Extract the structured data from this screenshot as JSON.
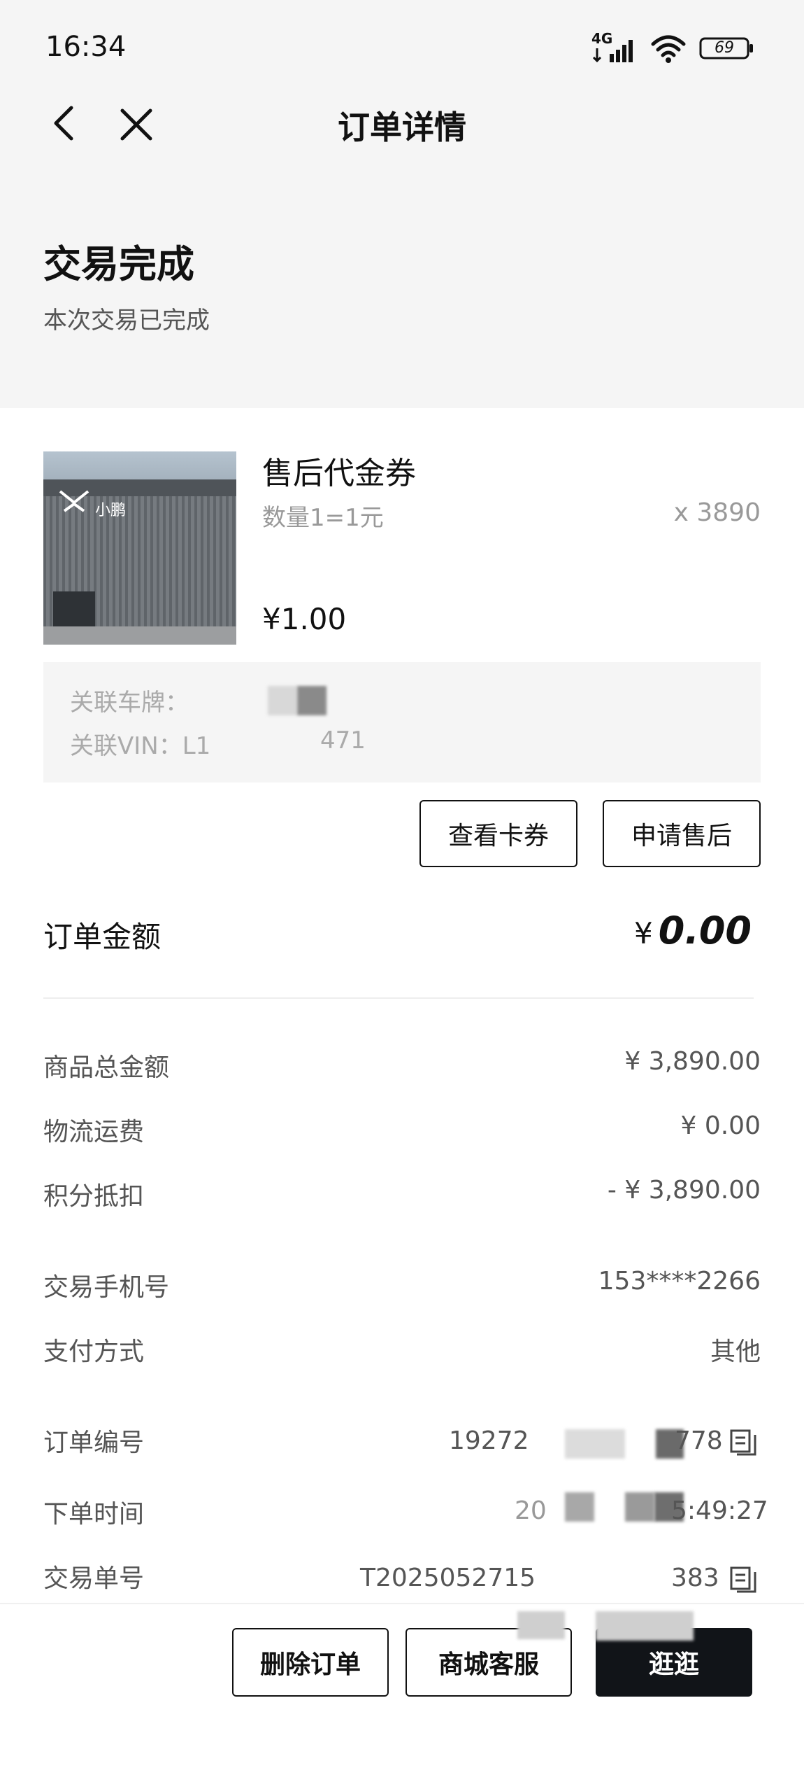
{
  "status_bar": {
    "time": "16:34",
    "network": "4G",
    "battery": "69"
  },
  "nav": {
    "title": "订单详情"
  },
  "order_status": {
    "title": "交易完成",
    "subtitle": "本次交易已完成"
  },
  "product": {
    "image_brand_text": "小鹏",
    "name": "售后代金券",
    "spec": "数量1=1元",
    "quantity": "x 3890",
    "price": "¥1.00"
  },
  "related": {
    "plate_label": "关联车牌：",
    "plate_value_partial": "",
    "vin_label": "关联VIN：",
    "vin_value_start": "L1",
    "vin_value_end": "471"
  },
  "actions": {
    "view_card": "查看卡券",
    "apply_after_sale": "申请售后"
  },
  "order_amount": {
    "label": "订单金额",
    "currency": "¥",
    "value": "0.00"
  },
  "price_rows": [
    {
      "label": "商品总金额",
      "value": "¥ 3,890.00"
    },
    {
      "label": "物流运费",
      "value": "¥ 0.00"
    },
    {
      "label": "积分抵扣",
      "value": "- ¥ 3,890.00"
    }
  ],
  "info_rows": [
    {
      "label": "交易手机号",
      "value": "153****2266"
    },
    {
      "label": "支付方式",
      "value": "其他"
    }
  ],
  "id_rows": [
    {
      "label": "订单编号",
      "value_start": "19272",
      "value_end": "778"
    },
    {
      "label": "下单时间",
      "value_start": "20",
      "value_end": "5:49:27"
    },
    {
      "label": "交易单号",
      "value_start": "T2025052715",
      "value_end": "383"
    }
  ],
  "bottom": {
    "delete_order": "删除订单",
    "customer_service": "商城客服",
    "browse": "逛逛"
  },
  "colors": {
    "header_bg": "#f5f5f5",
    "primary_dark": "#111418",
    "muted_text": "#999999"
  }
}
